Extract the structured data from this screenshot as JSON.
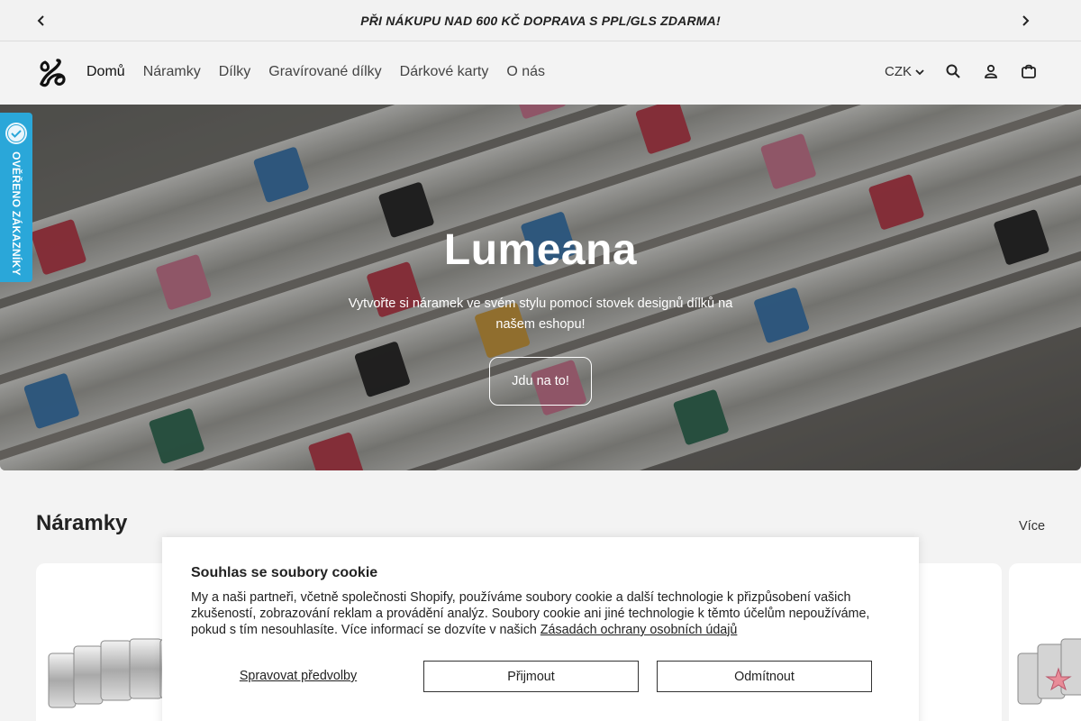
{
  "announcement": {
    "text": "PŘI NÁKUPU NAD 600 KČ DOPRAVA S PPL/GLS ZDARMA!",
    "prev_icon": "chevron-left-icon",
    "next_icon": "chevron-right-icon"
  },
  "header": {
    "logo_icon": "lumeana-logo-icon",
    "nav": [
      {
        "label": "Domů"
      },
      {
        "label": "Náramky"
      },
      {
        "label": "Dílky"
      },
      {
        "label": "Gravírované dílky"
      },
      {
        "label": "Dárkové karty"
      },
      {
        "label": "O nás"
      }
    ],
    "currency": "CZK",
    "icons": [
      "search-icon",
      "account-icon",
      "cart-icon"
    ]
  },
  "hero": {
    "title": "Lumeana",
    "subtitle": "Vytvořte si náramek ve svém stylu pomocí stovek designů dílků na našem eshopu!",
    "button_label": "Jdu na to!"
  },
  "trust_badge": {
    "label": "OVĚŘENO ZÁKAZNÍKY",
    "color": "#2aa7d9"
  },
  "section": {
    "title": "Náramky",
    "more_link": "Více"
  },
  "cookie_banner": {
    "title": "Souhlas se soubory cookie",
    "body": "My a naši partneři, včetně společnosti Shopify, používáme soubory cookie a další technologie k přizpůsobení vašich zkušeností, zobrazování reklam a provádění analýz. Soubory cookie ani jiné technologie k těmto účelům nepoužíváme, pokud s tím nesouhlasíte. Více informací se dozvíte v našich ",
    "policy_link": "Zásadách ochrany osobních údajů",
    "manage_label": "Spravovat předvolby",
    "accept_label": "Přijmout",
    "decline_label": "Odmítnout"
  }
}
